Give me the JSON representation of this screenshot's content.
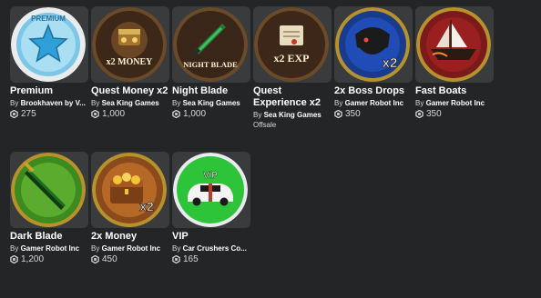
{
  "items": [
    {
      "title": "Premium",
      "by": "By",
      "creator": "Brookhaven by V...",
      "price": "275",
      "icon": "premium-star-icon"
    },
    {
      "title": "Quest Money x2",
      "by": "By",
      "creator": "Sea King Games",
      "price": "1,000",
      "icon": "quest-money-icon",
      "art_text": "x2 MONEY"
    },
    {
      "title": "Night Blade",
      "by": "By",
      "creator": "Sea King Games",
      "price": "1,000",
      "icon": "night-blade-icon",
      "art_text": "NIGHT BLADE"
    },
    {
      "title_line1": "Quest",
      "title_line2": "Experience x2",
      "by": "By",
      "creator": "Sea King Games",
      "status": "Offsale",
      "icon": "quest-exp-icon",
      "art_text": "x2 EXP"
    },
    {
      "title": "2x Boss Drops",
      "by": "By",
      "creator": "Gamer Robot Inc",
      "price": "350",
      "icon": "boss-drops-icon",
      "art_text": "x2"
    },
    {
      "title": "Fast Boats",
      "by": "By",
      "creator": "Gamer Robot Inc",
      "price": "350",
      "icon": "fast-boat-icon"
    },
    {
      "title": "Dark Blade",
      "by": "By",
      "creator": "Gamer Robot Inc",
      "price": "1,200",
      "icon": "dark-blade-icon"
    },
    {
      "title": "2x Money",
      "by": "By",
      "creator": "Gamer Robot Inc",
      "price": "450",
      "icon": "money-chest-icon",
      "art_text": "x2"
    },
    {
      "title": "VIP",
      "by": "By",
      "creator": "Car Crushers Co...",
      "price": "165",
      "icon": "vip-car-icon",
      "art_text": "VIP"
    }
  ],
  "premium_art_text": "PREMIUM"
}
